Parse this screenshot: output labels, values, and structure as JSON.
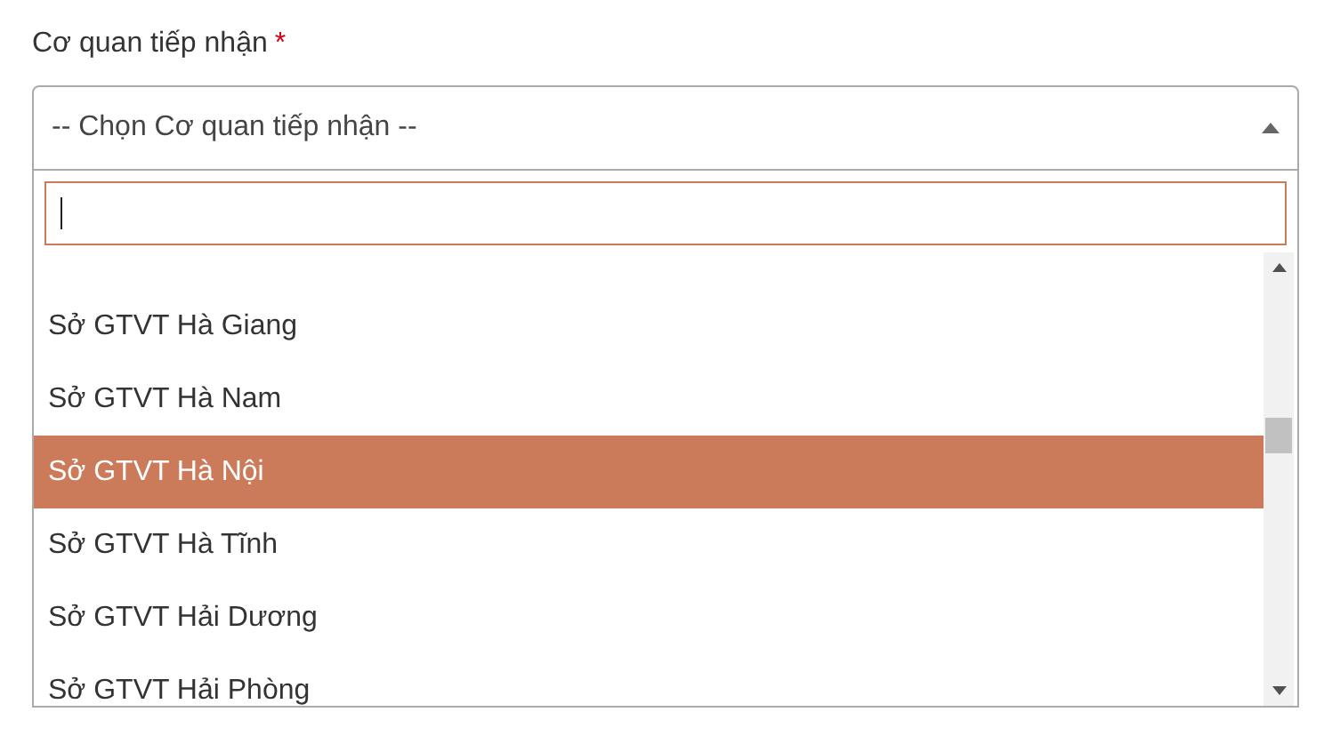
{
  "field": {
    "label": "Cơ quan tiếp nhận",
    "required_mark": "*",
    "placeholder": "-- Chọn Cơ quan tiếp nhận --",
    "expanded": true
  },
  "dropdown": {
    "search": {
      "focused": true
    },
    "options": [
      {
        "label": "Sở GTVT Hà Giang",
        "selected": false
      },
      {
        "label": "Sở GTVT Hà Nam",
        "selected": false
      },
      {
        "label": "Sở GTVT Hà Nội",
        "selected": true
      },
      {
        "label": "Sở GTVT Hà Tĩnh",
        "selected": false
      },
      {
        "label": "Sở GTVT Hải Dương",
        "selected": false
      },
      {
        "label": "Sở GTVT Hải Phòng",
        "selected": false
      }
    ]
  }
}
